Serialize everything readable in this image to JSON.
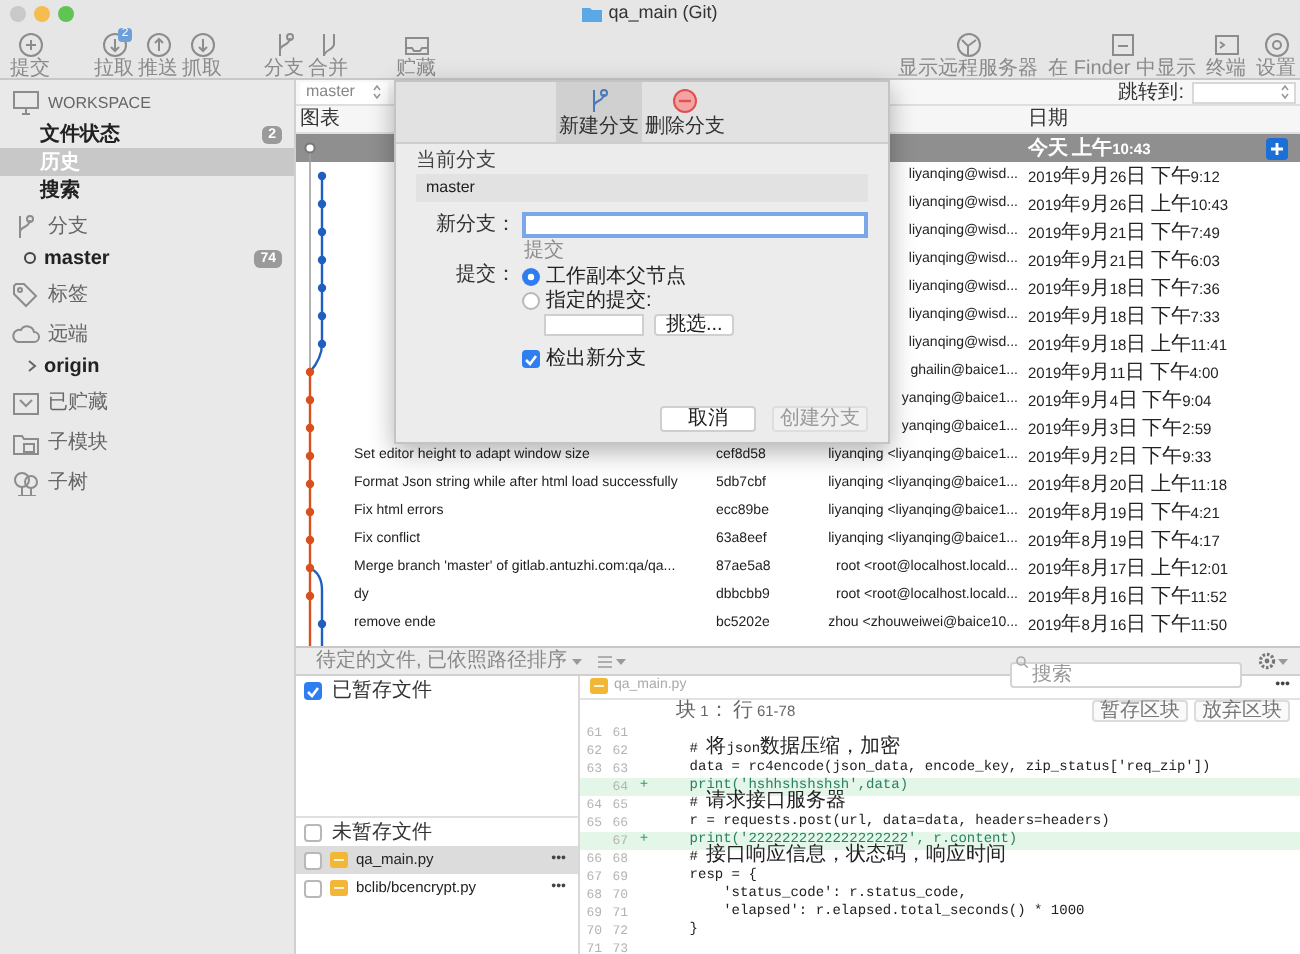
{
  "window": {
    "title": "qa_main (Git)"
  },
  "toolbar": {
    "left": [
      {
        "label": "提交"
      },
      {
        "label": "拉取",
        "badge": "2"
      },
      {
        "label": "推送"
      },
      {
        "label": "抓取"
      },
      {
        "label": "分支"
      },
      {
        "label": "合并"
      },
      {
        "label": "贮藏"
      }
    ],
    "right": [
      {
        "label": "显示远程服务器"
      },
      {
        "label": "在 Finder 中显示"
      },
      {
        "label": "终端"
      },
      {
        "label": "设置"
      }
    ]
  },
  "sidebar": {
    "sections": [
      {
        "title": "WORKSPACE",
        "items": [
          {
            "label": "文件状态",
            "badge": "2",
            "selected": false
          },
          {
            "label": "历史",
            "selected": true
          },
          {
            "label": "搜索",
            "selected": false
          }
        ]
      },
      {
        "title": "分支",
        "items": [
          {
            "label": "master",
            "badge": "74",
            "kind": "current-branch",
            "selected": false
          }
        ]
      },
      {
        "title": "标签"
      },
      {
        "title": "远端",
        "items": [
          {
            "label": "origin",
            "kind": "remote",
            "expanded": false,
            "selected": false
          }
        ]
      },
      {
        "title": "已贮藏"
      },
      {
        "title": "子模块"
      },
      {
        "title": "子树"
      }
    ]
  },
  "history": {
    "branch_filter": "master",
    "jump_to": "跳转到:",
    "columns": [
      {
        "label": "图表",
        "kind": "graph"
      },
      {
        "label": "日期",
        "kind": "date"
      }
    ],
    "working_copy": {
      "date": "今天 上午10:43"
    },
    "rows": [
      {
        "author": "liyanqing@wisd...",
        "date": "2019年9月26日 下午9:12",
        "color": "#1f5fbf"
      },
      {
        "author": "liyanqing@wisd...",
        "date": "2019年9月26日 上午10:43",
        "color": "#1f5fbf"
      },
      {
        "author": "liyanqing@wisd...",
        "date": "2019年9月21日 下午7:49",
        "color": "#1f5fbf"
      },
      {
        "author": "liyanqing@wisd...",
        "date": "2019年9月21日 下午6:03",
        "color": "#1f5fbf"
      },
      {
        "author": "liyanqing@wisd...",
        "date": "2019年9月18日 下午7:36",
        "color": "#1f5fbf"
      },
      {
        "author": "liyanqing@wisd...",
        "date": "2019年9月18日 下午7:33",
        "color": "#1f5fbf"
      },
      {
        "author": "liyanqing@wisd...",
        "date": "2019年9月18日 上午11:41",
        "color": "#1f5fbf"
      },
      {
        "author": "ghailin@baice1...",
        "date": "2019年9月11日 下午4:00",
        "color": "#d9501e"
      },
      {
        "author": "yanqing@baice1...",
        "date": "2019年9月4日 下午9:04",
        "color": "#d9501e"
      },
      {
        "author": "yanqing@baice1...",
        "date": "2019年9月3日 下午2:59",
        "color": "#d9501e"
      },
      {
        "description": "Set editor height to adapt window size",
        "commit": "cef8d58",
        "author": "liyanqing <liyanqing@baice1...",
        "date": "2019年9月2日 下午9:33",
        "color": "#d9501e"
      },
      {
        "description": "Format Json string while after html load successfully",
        "commit": "5db7cbf",
        "author": "liyanqing <liyanqing@baice1...",
        "date": "2019年8月20日 上午11:18",
        "color": "#d9501e"
      },
      {
        "description": "Fix html errors",
        "commit": "ecc89be",
        "author": "liyanqing <liyanqing@baice1...",
        "date": "2019年8月19日 下午4:21",
        "color": "#d9501e"
      },
      {
        "description": "Fix conflict",
        "commit": "63a8eef",
        "author": "liyanqing <liyanqing@baice1...",
        "date": "2019年8月19日 下午4:17",
        "color": "#d9501e"
      },
      {
        "description": "Merge branch 'master' of gitlab.antuzhi.com:qa/qa...",
        "commit": "87ae5a8",
        "author": "root <root@localhost.locald...",
        "date": "2019年8月17日 上午12:01",
        "color": "#d9501e"
      },
      {
        "description": "dy",
        "commit": "dbbcbb9",
        "author": "root <root@localhost.locald...",
        "date": "2019年8月16日 下午11:52",
        "color": "#d9501e"
      },
      {
        "description": "remove ende",
        "commit": "bc5202e",
        "author": "zhou <zhouweiwei@baice10...",
        "date": "2019年8月16日 下午11:50",
        "color": "#1f5fbf"
      }
    ]
  },
  "dialog": {
    "tabs": [
      {
        "label": "新建分支",
        "selected": true
      },
      {
        "label": "删除分支",
        "selected": false
      }
    ],
    "current_branch_label": "当前分支",
    "current_branch": "master",
    "new_branch_label": "新分支：",
    "new_branch_focused": true,
    "hint": "提交",
    "commit_label": "提交：",
    "commit_options": [
      {
        "label": "工作副本父节点",
        "selected": true
      },
      {
        "label": "指定的提交:",
        "selected": false
      }
    ],
    "pick_button": "挑选...",
    "checkout": {
      "label": "检出新分支",
      "checked": true
    },
    "buttons": [
      {
        "label": "取消",
        "disabled": false
      },
      {
        "label": "创建分支",
        "disabled": true
      }
    ]
  },
  "changes": {
    "sort_label": "待定的文件, 已依照路径排序",
    "search_placeholder": "搜索",
    "staged": {
      "label": "已暂存文件",
      "checked": true
    },
    "unstaged": {
      "label": "未暂存文件",
      "checked": false
    },
    "files": [
      {
        "name": "qa_main.py",
        "more": "•••",
        "checked": false,
        "selected": true
      },
      {
        "name": "bclib/bcencrypt.py",
        "more": "•••",
        "checked": false,
        "selected": false
      }
    ],
    "diff": {
      "file": "qa_main.py",
      "more": "•••",
      "hunk": "块 1： 行 61-78",
      "buttons": [
        "暂存区块",
        "放弃区块"
      ],
      "lines": [
        {
          "old": "61",
          "new": "61",
          "kind": "context"
        },
        {
          "old": "62",
          "new": "62",
          "kind": "context",
          "text": "    # 将json数据压缩，加密"
        },
        {
          "old": "63",
          "new": "63",
          "kind": "context",
          "text": "    data = rc4encode(json_data, encode_key, zip_status['req_zip'])"
        },
        {
          "new": "64",
          "kind": "added",
          "sign": "+",
          "text": "    print('hshhshshshsh',data)"
        },
        {
          "old": "64",
          "new": "65",
          "kind": "context",
          "text": "    # 请求接口服务器"
        },
        {
          "old": "65",
          "new": "66",
          "kind": "context",
          "text": "    r = requests.post(url, data=data, headers=headers)"
        },
        {
          "new": "67",
          "kind": "added",
          "sign": "+",
          "text": "    print('2222222222222222222', r.content)"
        },
        {
          "old": "66",
          "new": "68",
          "kind": "context",
          "text": "    # 接口响应信息，状态码，响应时间"
        },
        {
          "old": "67",
          "new": "69",
          "kind": "context",
          "text": "    resp = {"
        },
        {
          "old": "68",
          "new": "70",
          "kind": "context",
          "text": "        'status_code': r.status_code,"
        },
        {
          "old": "69",
          "new": "71",
          "kind": "context",
          "text": "        'elapsed': r.elapsed.total_seconds() * 1000"
        },
        {
          "old": "70",
          "new": "72",
          "kind": "context",
          "text": "    }"
        },
        {
          "old": "71",
          "new": "73",
          "kind": "context"
        }
      ]
    }
  }
}
